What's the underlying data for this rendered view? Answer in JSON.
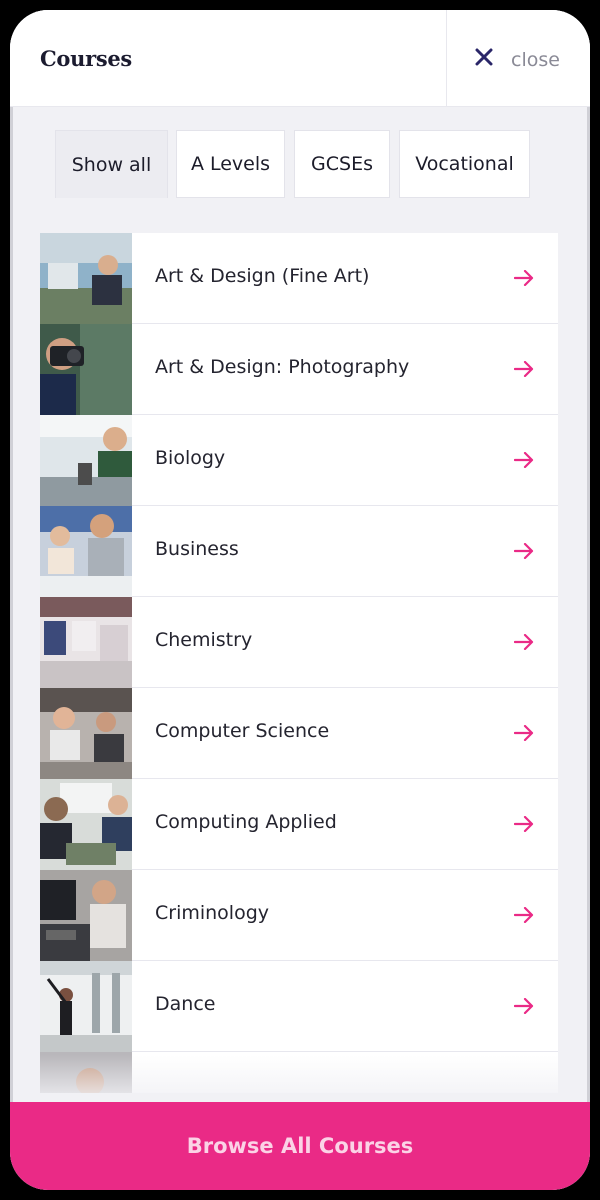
{
  "header": {
    "title": "Courses",
    "close_label": "close"
  },
  "tabs": [
    {
      "label": "Show all",
      "active": true
    },
    {
      "label": "A Levels",
      "active": false
    },
    {
      "label": "GCSEs",
      "active": false
    },
    {
      "label": "Vocational",
      "active": false
    }
  ],
  "courses": [
    {
      "label": "Art & Design (Fine Art)"
    },
    {
      "label": "Art & Design: Photography"
    },
    {
      "label": "Biology"
    },
    {
      "label": "Business"
    },
    {
      "label": "Chemistry"
    },
    {
      "label": "Computer Science"
    },
    {
      "label": "Computing Applied"
    },
    {
      "label": "Criminology"
    },
    {
      "label": "Dance"
    }
  ],
  "footer": {
    "browse_label": "Browse All Courses"
  },
  "colors": {
    "accent": "#ea2a86",
    "close_icon": "#2a2668"
  },
  "icons": {
    "close": "close-icon",
    "row_arrow": "arrow-right-icon"
  }
}
